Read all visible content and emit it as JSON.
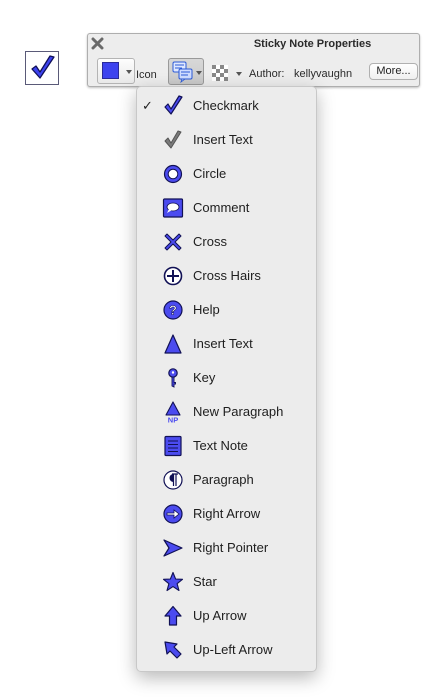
{
  "palette": {
    "title": "Sticky Note Properties",
    "icon_label": "Icon",
    "author_label": "Author:",
    "author_name": "kellyvaughn",
    "more_label": "More...",
    "fill_color": "#3d43ef"
  },
  "menu": {
    "items": [
      {
        "label": "Checkmark",
        "icon": "checkmark-icon",
        "checked": true
      },
      {
        "label": "Insert Text",
        "icon": "insert-text-check-icon",
        "checked": false
      },
      {
        "label": "Circle",
        "icon": "circle-icon",
        "checked": false
      },
      {
        "label": "Comment",
        "icon": "comment-icon",
        "checked": false
      },
      {
        "label": "Cross",
        "icon": "cross-icon",
        "checked": false
      },
      {
        "label": "Cross Hairs",
        "icon": "cross-hairs-icon",
        "checked": false
      },
      {
        "label": "Help",
        "icon": "help-icon",
        "checked": false
      },
      {
        "label": "Insert Text",
        "icon": "insert-text-triangle-icon",
        "checked": false
      },
      {
        "label": "Key",
        "icon": "key-icon",
        "checked": false
      },
      {
        "label": "New Paragraph",
        "icon": "new-paragraph-icon",
        "checked": false
      },
      {
        "label": "Text Note",
        "icon": "text-note-icon",
        "checked": false
      },
      {
        "label": "Paragraph",
        "icon": "paragraph-icon",
        "checked": false
      },
      {
        "label": "Right Arrow",
        "icon": "right-arrow-icon",
        "checked": false
      },
      {
        "label": "Right Pointer",
        "icon": "right-pointer-icon",
        "checked": false
      },
      {
        "label": "Star",
        "icon": "star-icon",
        "checked": false
      },
      {
        "label": "Up Arrow",
        "icon": "up-arrow-icon",
        "checked": false
      },
      {
        "label": "Up-Left Arrow",
        "icon": "up-left-arrow-icon",
        "checked": false
      }
    ]
  }
}
